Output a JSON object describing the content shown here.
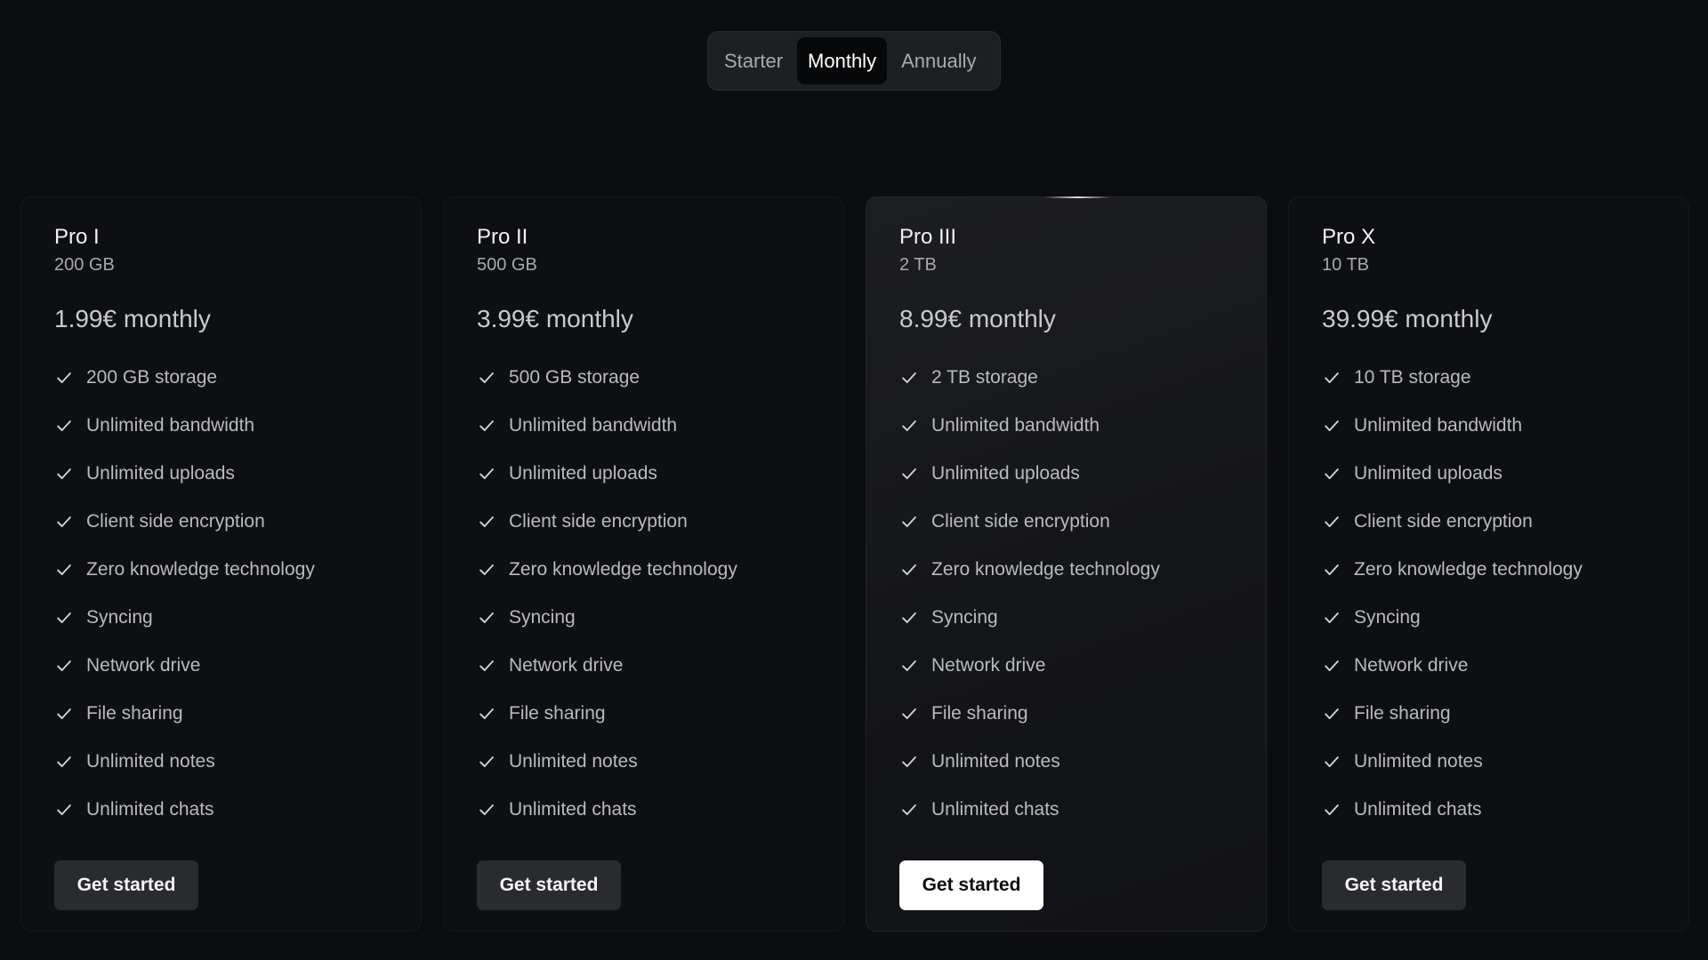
{
  "billing_toggle": {
    "options": [
      "Starter",
      "Monthly",
      "Annually"
    ],
    "selected": "Monthly"
  },
  "plans": [
    {
      "name": "Pro I",
      "storage": "200 GB",
      "price": "1.99€ monthly",
      "features": [
        "200 GB storage",
        "Unlimited bandwidth",
        "Unlimited uploads",
        "Client side encryption",
        "Zero knowledge technology",
        "Syncing",
        "Network drive",
        "File sharing",
        "Unlimited notes",
        "Unlimited chats"
      ],
      "cta": "Get started"
    },
    {
      "name": "Pro II",
      "storage": "500 GB",
      "price": "3.99€ monthly",
      "features": [
        "500 GB storage",
        "Unlimited bandwidth",
        "Unlimited uploads",
        "Client side encryption",
        "Zero knowledge technology",
        "Syncing",
        "Network drive",
        "File sharing",
        "Unlimited notes",
        "Unlimited chats"
      ],
      "cta": "Get started"
    },
    {
      "name": "Pro III",
      "storage": "2 TB",
      "price": "8.99€ monthly",
      "features": [
        "2 TB storage",
        "Unlimited bandwidth",
        "Unlimited uploads",
        "Client side encryption",
        "Zero knowledge technology",
        "Syncing",
        "Network drive",
        "File sharing",
        "Unlimited notes",
        "Unlimited chats"
      ],
      "cta": "Get started",
      "featured": true
    },
    {
      "name": "Pro X",
      "storage": "10 TB",
      "price": "39.99€ monthly",
      "features": [
        "10 TB storage",
        "Unlimited bandwidth",
        "Unlimited uploads",
        "Client side encryption",
        "Zero knowledge technology",
        "Syncing",
        "Network drive",
        "File sharing",
        "Unlimited notes",
        "Unlimited chats"
      ],
      "cta": "Get started"
    }
  ],
  "icons": {
    "feature_check": "check-icon"
  },
  "colors": {
    "background": "#0c0d10",
    "card": "#0e0f12",
    "featured_card": "#1d1e22",
    "primary_button": "#ffffff",
    "secondary_button": "#2a2b2f"
  }
}
